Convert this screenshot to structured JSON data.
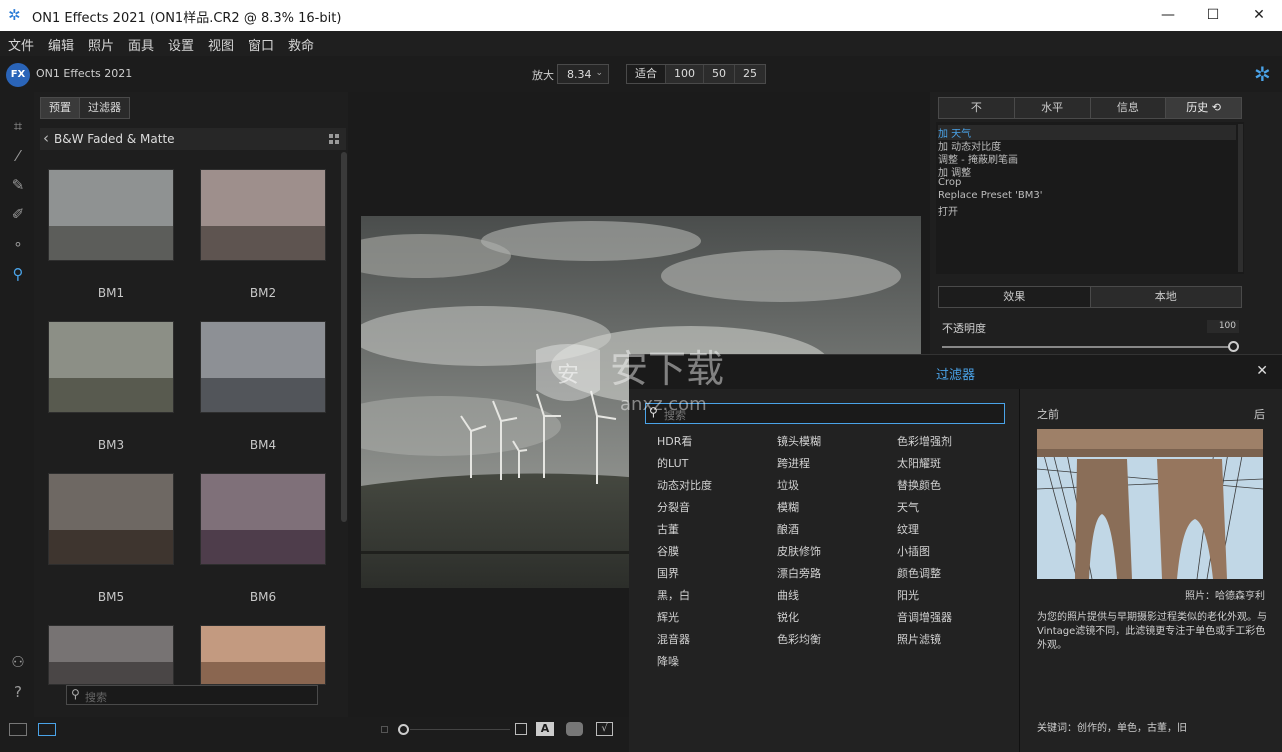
{
  "window": {
    "title": "ON1 Effects 2021 (ON1样品.CR2 @ 8.3% 16-bit)",
    "minimize": "—",
    "maximize": "☐",
    "close": "✕"
  },
  "menu": [
    "文件",
    "编辑",
    "照片",
    "面具",
    "设置",
    "视图",
    "窗口",
    "救命"
  ],
  "appbar": {
    "logo": "FX",
    "title": "ON1 Effects 2021",
    "zoom_label": "放大",
    "zoom_value": "8.34",
    "zoom_buttons": [
      "适合",
      "100",
      "50",
      "25"
    ]
  },
  "browser": {
    "tabs": [
      "预置",
      "过滤器"
    ],
    "category": "B&W Faded & Matte",
    "presets": [
      {
        "label": "BM1",
        "sky": "#8f9292",
        "land": "#5c5d5a"
      },
      {
        "label": "BM2",
        "sky": "#9e8f8c",
        "land": "#5e5450"
      },
      {
        "label": "BM3",
        "sky": "#8c8f86",
        "land": "#585a4f"
      },
      {
        "label": "BM4",
        "sky": "#8d9095",
        "land": "#52555a"
      },
      {
        "label": "BM5",
        "sky": "#6e6863",
        "land": "#3e352f"
      },
      {
        "label": "BM6",
        "sky": "#7f7079",
        "land": "#4e3d4b"
      },
      {
        "label": "",
        "sky": "#777373",
        "land": "#4a4646"
      },
      {
        "label": "",
        "sky": "#c39a80",
        "land": "#8a6650"
      }
    ],
    "search_placeholder": "搜索"
  },
  "right_panel": {
    "tabs": [
      "不",
      "水平",
      "信息",
      "历史 ⟲"
    ],
    "history": [
      "加 天气",
      "加 动态对比度",
      "调整 - 掩蔽刷笔画",
      "加 调整",
      "Crop",
      "Replace Preset 'BM3'",
      "打开"
    ],
    "effect_tabs": [
      "效果",
      "本地"
    ],
    "opacity_label": "不透明度",
    "opacity_value": "100"
  },
  "filters_dialog": {
    "title": "过滤器",
    "search_placeholder": "搜索",
    "columns": [
      [
        "HDR看",
        "的LUT",
        "动态对比度",
        "分裂音",
        "古董",
        "谷膜",
        "国界",
        "黑，白",
        "辉光",
        "混音器",
        "降噪"
      ],
      [
        "镜头模糊",
        "跨进程",
        "垃圾",
        "模糊",
        "酿酒",
        "皮肤修饰",
        "漂白旁路",
        "曲线",
        "锐化",
        "色彩均衡"
      ],
      [
        "色彩增强剂",
        "太阳耀斑",
        "替换颜色",
        "天气",
        "纹理",
        "小插图",
        "颜色调整",
        "阳光",
        "音调增强器",
        "照片滤镜"
      ]
    ],
    "before_label": "之前",
    "after_label": "后",
    "photo_credit": "照片：哈德森亨利",
    "description": "为您的照片提供与早期摄影过程类似的老化外观。与Vintage滤镜不同，此滤镜更专注于单色或手工彩色外观。",
    "keywords": "关键词：创作的，单色，古董，旧"
  },
  "watermark": {
    "text": "安下载",
    "sub": "anxz.com"
  }
}
